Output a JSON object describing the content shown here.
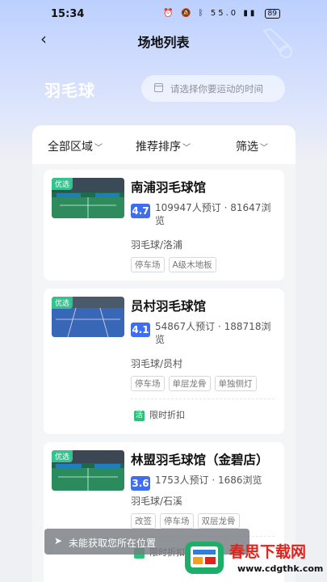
{
  "status_bar": {
    "time": "15:34",
    "speed_top": "55.0",
    "speed_unit": "KB/S",
    "battery": "89"
  },
  "nav": {
    "title": "场地列表"
  },
  "hero": {
    "sport": "羽毛球",
    "time_placeholder": "请选择你要运动的时间"
  },
  "filters": {
    "region": "全部区域",
    "sort": "推荐排序",
    "filter": "筛选"
  },
  "venues": [
    {
      "badge": "优选",
      "name": "南浦羽毛球馆",
      "rating": "4.7",
      "bookings": "109947人预订",
      "views": "81647浏览",
      "category": "羽毛球/洛浦",
      "tags": [
        "停车场",
        "A级木地板"
      ],
      "promo": ""
    },
    {
      "badge": "优选",
      "name": "员村羽毛球馆",
      "rating": "4.1",
      "bookings": "54867人预订",
      "views": "188718浏览",
      "category": "羽毛球/员村",
      "tags": [
        "停车场",
        "单层龙骨",
        "单独侧灯"
      ],
      "promo": "限时折扣",
      "promo_icon": "活"
    },
    {
      "badge": "优选",
      "name": "林盟羽毛球馆（金碧店）",
      "rating": "3.6",
      "bookings": "1753人预订",
      "views": "1686浏览",
      "category": "羽毛球/石溪",
      "tags": [
        "改签",
        "停车场",
        "双层龙骨"
      ],
      "promo": "限时折扣"
    }
  ],
  "location_toast": "未能获取您所在位置",
  "watermark": {
    "text": "春思下载网",
    "url": "www.cdgthk.com"
  },
  "colors": {
    "accent": "#3e6df0",
    "badge": "#34c38f",
    "promo": "#2fbf79",
    "hero_top": "#bcd0ff"
  }
}
